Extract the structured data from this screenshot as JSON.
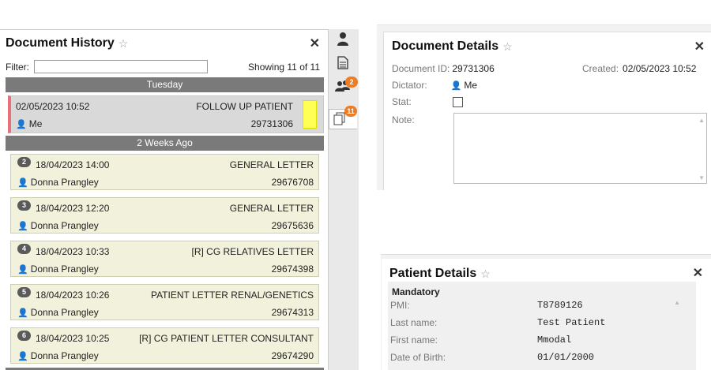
{
  "history": {
    "title": "Document History",
    "filter_label": "Filter:",
    "filter_value": "",
    "showing": "Showing 11 of 11",
    "groups": [
      {
        "label": "Tuesday"
      },
      {
        "label": "2 Weeks Ago"
      }
    ],
    "selected": {
      "datetime": "02/05/2023 10:52",
      "user": "Me",
      "type": "FOLLOW UP PATIENT",
      "doc_id": "29731306"
    },
    "items": [
      {
        "num": "2",
        "datetime": "18/04/2023 14:00",
        "user": "Donna Prangley",
        "type": "GENERAL LETTER",
        "doc_id": "29676708"
      },
      {
        "num": "3",
        "datetime": "18/04/2023 12:20",
        "user": "Donna Prangley",
        "type": "GENERAL LETTER",
        "doc_id": "29675636"
      },
      {
        "num": "4",
        "datetime": "18/04/2023 10:33",
        "user": "Donna Prangley",
        "type": "[R] CG RELATIVES LETTER",
        "doc_id": "29674398"
      },
      {
        "num": "5",
        "datetime": "18/04/2023 10:26",
        "user": "Donna Prangley",
        "type": "PATIENT LETTER RENAL/GENETICS",
        "doc_id": "29674313"
      },
      {
        "num": "6",
        "datetime": "18/04/2023 10:25",
        "user": "Donna Prangley",
        "type": "[R] CG PATIENT LETTER CONSULTANT",
        "doc_id": "29674290"
      }
    ]
  },
  "tabs": {
    "contacts_badge": "2",
    "documents_badge": "11"
  },
  "details": {
    "title": "Document Details",
    "doc_id_label": "Document ID:",
    "doc_id": "29731306",
    "created_label": "Created:",
    "created": "02/05/2023 10:52",
    "dictator_label": "Dictator:",
    "dictator": "Me",
    "stat_label": "Stat:",
    "note_label": "Note:"
  },
  "patient": {
    "title": "Patient Details",
    "section": "Mandatory",
    "fields": [
      {
        "label": "PMI:",
        "value": "T8789126"
      },
      {
        "label": "Last name:",
        "value": "Test Patient"
      },
      {
        "label": "First name:",
        "value": "Mmodal"
      },
      {
        "label": "Date of Birth:",
        "value": "01/01/2000"
      }
    ]
  },
  "colors": {
    "accent_orange": "#ee7c22",
    "group_header": "#7a7a7a",
    "item_bg": "#f2f2dc",
    "selected_marker": "#e8707a",
    "sticky_note": "#ffff55"
  }
}
